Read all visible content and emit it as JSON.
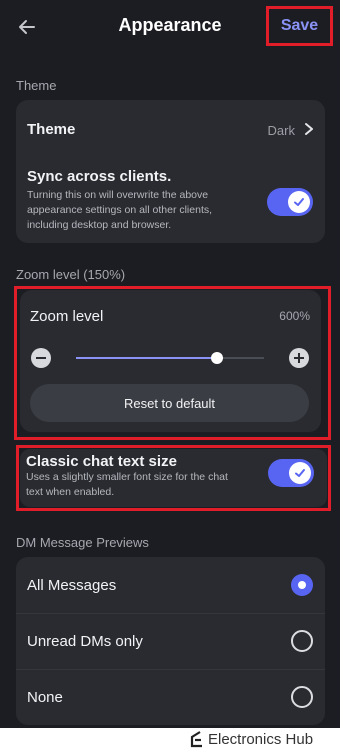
{
  "header": {
    "title": "Appearance",
    "save_label": "Save"
  },
  "theme_section": {
    "label": "Theme",
    "theme_row": {
      "title": "Theme",
      "value": "Dark"
    },
    "sync_row": {
      "title": "Sync across clients.",
      "description": "Turning this on will overwrite the above appearance settings on all other clients, including desktop and browser.",
      "enabled": true
    }
  },
  "zoom_section": {
    "label": "Zoom level (150%)",
    "title": "Zoom level",
    "value": "600%",
    "slider_fraction": 0.75,
    "reset_label": "Reset to default"
  },
  "classic_chat": {
    "title": "Classic chat text size",
    "description": "Uses a slightly smaller font size for the chat text when enabled.",
    "enabled": true
  },
  "dm_section": {
    "label": "DM Message Previews",
    "options": [
      {
        "label": "All Messages",
        "selected": true
      },
      {
        "label": "Unread DMs only",
        "selected": false
      },
      {
        "label": "None",
        "selected": false
      }
    ]
  },
  "watermark": {
    "text": "Electronics Hub"
  },
  "colors": {
    "accent": "#5865f2",
    "highlight_border": "#e11d2a",
    "background": "#1c1d22",
    "card": "#2a2b31"
  }
}
